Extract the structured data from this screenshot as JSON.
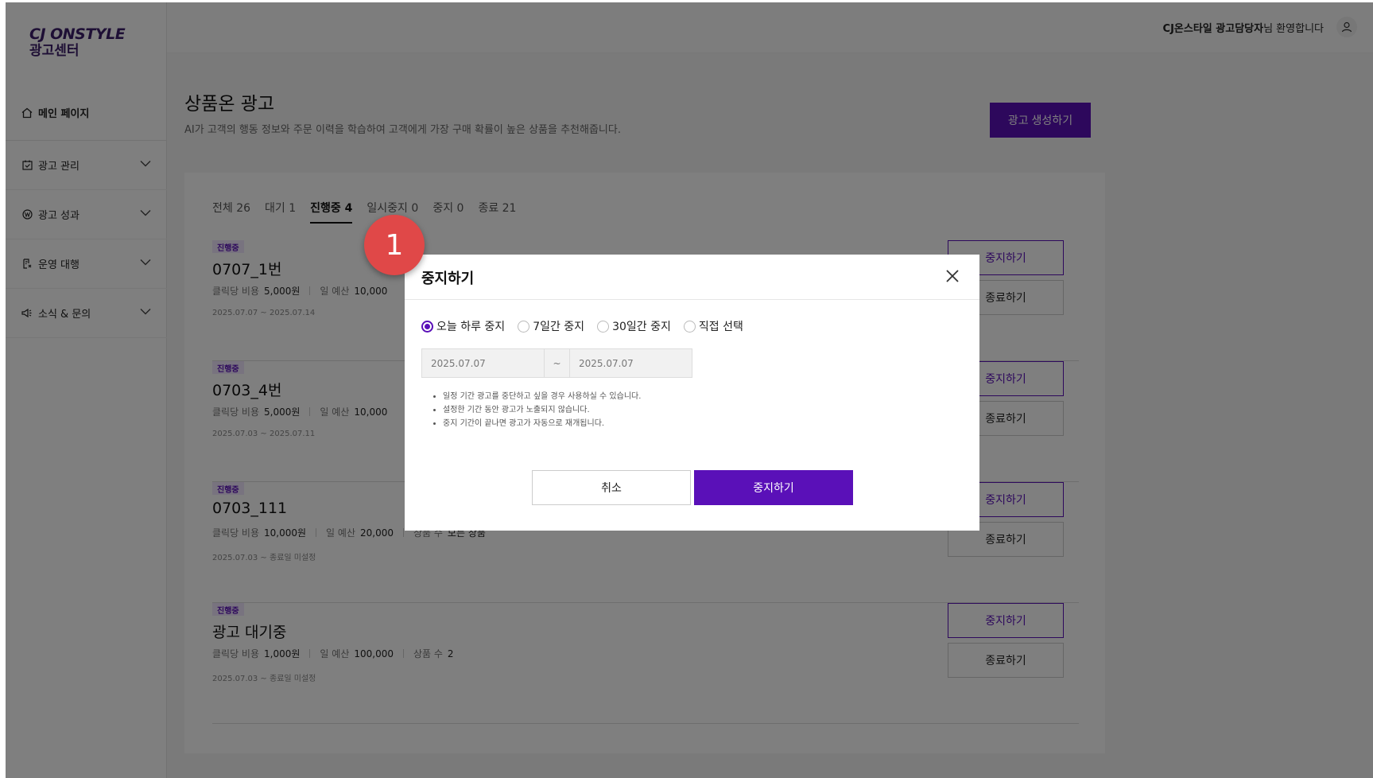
{
  "brand": {
    "logo_line1": "CJ ONSTYLE",
    "logo_line2": "광고센터"
  },
  "header": {
    "user_name": "CJ온스타일 광고담당자",
    "welcome_suffix": "님 환영합니다"
  },
  "sidebar": {
    "home": "메인 페이지",
    "items": [
      {
        "label": "광고 관리",
        "icon": "calendar-check-icon"
      },
      {
        "label": "광고 성과",
        "icon": "won-coin-icon"
      },
      {
        "label": "운영 대행",
        "icon": "document-edit-icon"
      },
      {
        "label": "소식 & 문의",
        "icon": "megaphone-icon"
      }
    ]
  },
  "page": {
    "title": "상품온 광고",
    "description": "AI가 고객의 행동 정보와 주문 이력을 학습하여 고객에게 가장 구매 확률이 높은 상품을 추천해줍니다.",
    "create_button": "광고 생성하기"
  },
  "tabs": [
    {
      "label": "전체 26"
    },
    {
      "label": "대기 1"
    },
    {
      "label": "진행중 4",
      "active": true
    },
    {
      "label": "일시중지 0"
    },
    {
      "label": "중지 0"
    },
    {
      "label": "종료 21"
    }
  ],
  "labels": {
    "cpc": "클릭당 비용",
    "daily_budget": "일 예산",
    "product_count": "상품 수",
    "stop": "중지하기",
    "end": "종료하기"
  },
  "ads": [
    {
      "status": "진행중",
      "name": "0707_1번",
      "cpc": "5,000원",
      "budget": "10,000",
      "products": "",
      "period": "2025.07.07 ~ 2025.07.14"
    },
    {
      "status": "진행중",
      "name": "0703_4번",
      "cpc": "5,000원",
      "budget": "10,000",
      "products": "",
      "period": "2025.07.03 ~ 2025.07.11"
    },
    {
      "status": "진행중",
      "name": "0703_111",
      "cpc": "10,000원",
      "budget": "20,000",
      "products": "모든 상품",
      "period": "2025.07.03 ~ 종료일 미설정"
    },
    {
      "status": "진행중",
      "name": "광고 대기중",
      "cpc": "1,000원",
      "budget": "100,000",
      "products": "2",
      "period": "2025.07.03 ~ 종료일 미설정"
    }
  ],
  "modal": {
    "title": "중지하기",
    "options": [
      {
        "label": "오늘 하루 중지",
        "selected": true
      },
      {
        "label": "7일간 중지",
        "selected": false
      },
      {
        "label": "30일간 중지",
        "selected": false
      },
      {
        "label": "직접 선택",
        "selected": false
      }
    ],
    "date_start": "2025.07.07",
    "date_separator": "~",
    "date_end": "2025.07.07",
    "notes": [
      "일정 기간 광고를 중단하고 싶을 경우 사용하실 수 있습니다.",
      "설정한 기간 동안 광고가 노출되지 않습니다.",
      "중지 기간이 끝나면 광고가 자동으로 재개됩니다."
    ],
    "cancel": "취소",
    "confirm": "중지하기"
  },
  "step_marker": "1",
  "colors": {
    "accent": "#5a10b8",
    "marker": "#e04848",
    "brand": "#3d1e6b"
  }
}
